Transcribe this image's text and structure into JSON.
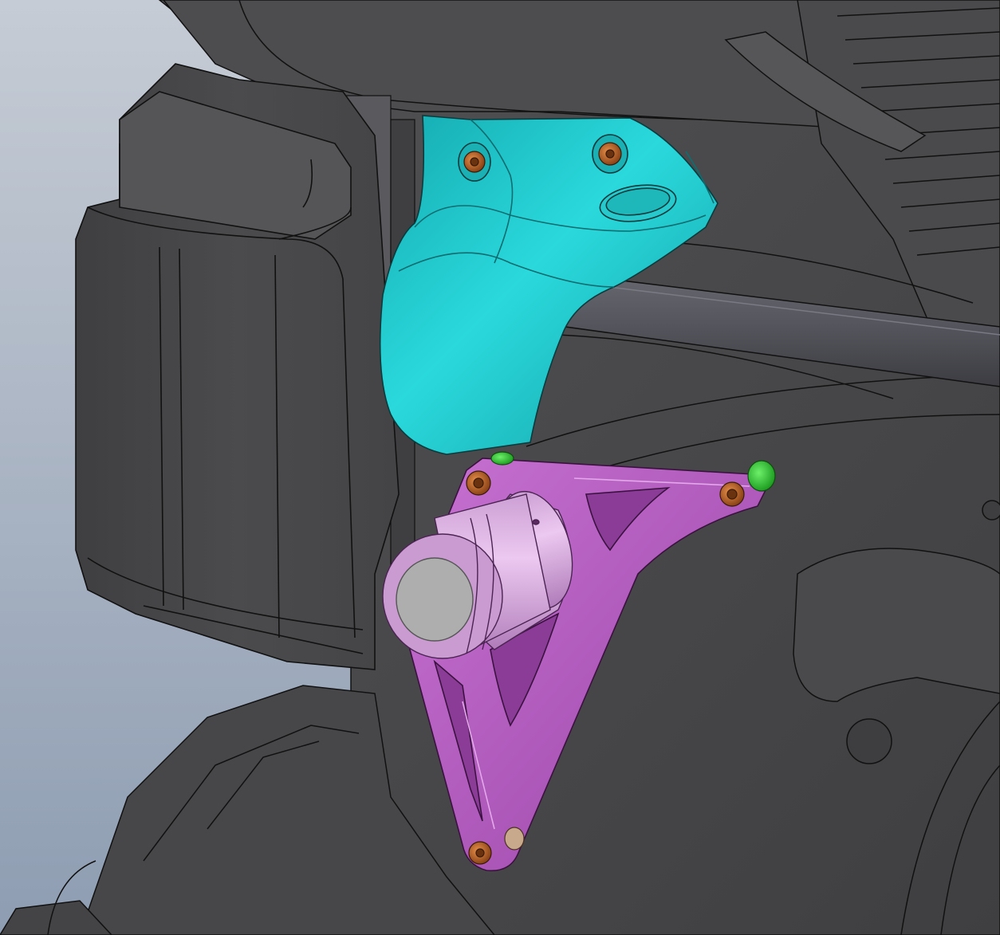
{
  "scene": {
    "description_visible_text": "",
    "background_colors": {
      "top": "#c4cad3",
      "bottom": "#95a3b6"
    },
    "body_color": "#4a4a4c",
    "body_line_color": "#111111",
    "parts": {
      "bracket": {
        "color": "#b55bc2",
        "highlight": "#e4b3e8",
        "icon": "triangular-mount-bracket"
      },
      "cover": {
        "color": "#1fc4c7",
        "highlight": "#46e3e3",
        "icon": "shaped-guard-cover"
      },
      "bolts": {
        "color": "#c96a2b",
        "icon": "hex-socket-bolt"
      },
      "spacers": {
        "color": "#3bcf3d",
        "icon": "cylindrical-spacer"
      },
      "frame_tube": {
        "color": "#5a5a63"
      }
    }
  }
}
